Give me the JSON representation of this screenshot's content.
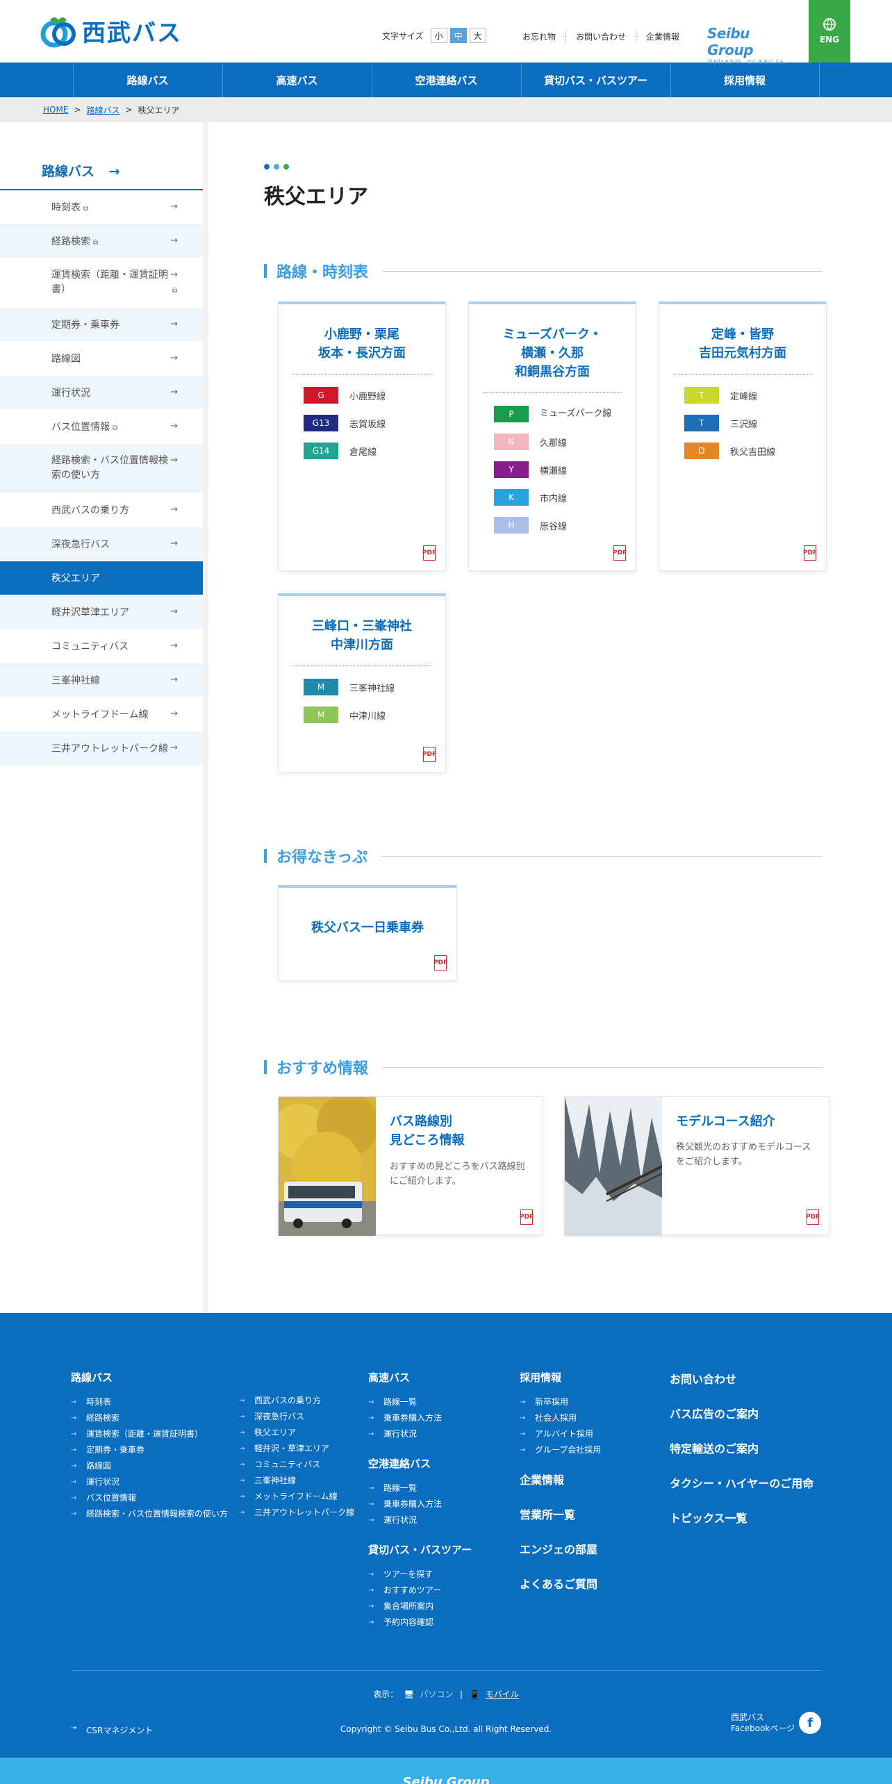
{
  "header": {
    "logo_text": "西武バス",
    "font_size_label": "文字サイズ",
    "font_sizes": [
      "小",
      "中",
      "大"
    ],
    "links": [
      "お忘れ物",
      "お問い合わせ",
      "企業情報"
    ],
    "group_logo": "Seibu Group",
    "group_tagline": "でかけるたび、はじまるじぶん。",
    "eng": "ENG"
  },
  "nav": [
    "路線バス",
    "高速バス",
    "空港連絡バス",
    "貸切バス・バスツアー",
    "採用情報"
  ],
  "breadcrumb": {
    "home": "HOME",
    "sep": ">",
    "parent": "路線バス",
    "current": "秩父エリア"
  },
  "sidebar": {
    "title": "路線バス",
    "items": [
      {
        "label": "時刻表",
        "ext": true
      },
      {
        "label": "経路検索",
        "ext": true
      },
      {
        "label": "運賃検索（距離・運賃証明書）",
        "ext": true
      },
      {
        "label": "定期券・乗車券",
        "ext": false
      },
      {
        "label": "路線図",
        "ext": false
      },
      {
        "label": "運行状況",
        "ext": false
      },
      {
        "label": "バス位置情報",
        "ext": true
      },
      {
        "label": "経路検索・バス位置情報検索の使い方",
        "ext": false
      },
      {
        "label": "西武バスの乗り方",
        "ext": false
      },
      {
        "label": "深夜急行バス",
        "ext": false
      },
      {
        "label": "秩父エリア",
        "ext": false,
        "active": true
      },
      {
        "label": "軽井沢草津エリア",
        "ext": false
      },
      {
        "label": "コミュニティバス",
        "ext": false
      },
      {
        "label": "三峯神社線",
        "ext": false
      },
      {
        "label": "メットライフドーム線",
        "ext": false
      },
      {
        "label": "三井アウトレットパーク線",
        "ext": false
      }
    ]
  },
  "main": {
    "title": "秩父エリア",
    "dot_colors": [
      "#0a6dbf",
      "#3ab0e8",
      "#3ba847"
    ],
    "section_routes": "路線・時刻表",
    "route_cards": [
      {
        "title": [
          "小鹿野・栗尾",
          "坂本・長沢方面"
        ],
        "routes": [
          {
            "code": "G",
            "name": "小鹿野線",
            "color": "#d0172b"
          },
          {
            "code": "G13",
            "name": "志賀坂線",
            "color": "#1f2c7f"
          },
          {
            "code": "G14",
            "name": "倉尾線",
            "color": "#1fa591"
          }
        ]
      },
      {
        "title": [
          "ミューズパーク・",
          "横瀬・久那",
          "和銅黒谷方面"
        ],
        "routes": [
          {
            "code": "P",
            "name": "ミューズパーク線",
            "color": "#1a9a4a"
          },
          {
            "code": "N",
            "name": "久那線",
            "color": "#f3b6bd"
          },
          {
            "code": "Y",
            "name": "横瀬線",
            "color": "#8b1d8a"
          },
          {
            "code": "K",
            "name": "市内線",
            "color": "#2aa2de"
          },
          {
            "code": "H",
            "name": "原谷線",
            "color": "#a9bfe6"
          }
        ]
      },
      {
        "title": [
          "定峰・皆野",
          "吉田元気村方面"
        ],
        "routes": [
          {
            "code": "T",
            "name": "定峰線",
            "color": "#c8d62e"
          },
          {
            "code": "T",
            "name": "三沢線",
            "color": "#1f6db5"
          },
          {
            "code": "D",
            "name": "秩父吉田線",
            "color": "#e38623"
          }
        ]
      },
      {
        "title": [
          "三峰口・三峯神社",
          "中津川方面"
        ],
        "routes": [
          {
            "code": "M",
            "name": "三峯神社線",
            "color": "#1d8aaa"
          },
          {
            "code": "M",
            "name": "中津川線",
            "color": "#8cc656"
          }
        ]
      }
    ],
    "section_ticket": "お得なきっぷ",
    "ticket_title": "秩父バス一日乗車券",
    "section_rec": "おすすめ情報",
    "rec_cards": [
      {
        "title": [
          "バス路線別",
          "見どころ情報"
        ],
        "desc": "おすすめの見どころをバス路線別にご紹介します。"
      },
      {
        "title": [
          "モデルコース紹介"
        ],
        "desc": "秩父観光のおすすめモデルコースをご紹介します。"
      }
    ],
    "pdf_icon": "pdf-icon"
  },
  "footer": {
    "col1": {
      "head": "路線バス",
      "left": [
        "時刻表",
        "経路検索",
        "運賃検索（距離・運賃証明書）",
        "定期券・乗車券",
        "路線図",
        "運行状況",
        "バス位置情報",
        "経路検索・バス位置情報検索の使い方"
      ],
      "right": [
        "西武バスの乗り方",
        "深夜急行バス",
        "秩父エリア",
        "軽井沢・草津エリア",
        "コミュニティバス",
        "三峯神社線",
        "メットライフドーム線",
        "三井アウトレットパーク線"
      ]
    },
    "col2": [
      {
        "head": "高速バス",
        "items": [
          "路線一覧",
          "乗車券購入方法",
          "運行状況"
        ]
      },
      {
        "head": "空港連絡バス",
        "items": [
          "路線一覧",
          "乗車券購入方法",
          "運行状況"
        ]
      },
      {
        "head": "貸切バス・バスツアー",
        "items": [
          "ツアーを探す",
          "おすすめツアー",
          "集合場所案内",
          "予約内容確認"
        ]
      }
    ],
    "col3": {
      "head": "採用情報",
      "items": [
        "新卒採用",
        "社会人採用",
        "アルバイト採用",
        "グループ会社採用"
      ],
      "links": [
        "企業情報",
        "営業所一覧",
        "エンジェの部屋",
        "よくあるご質問"
      ]
    },
    "col4": [
      "お問い合わせ",
      "バス広告のご案内",
      "特定輸送のご案内",
      "タクシー・ハイヤーのご用命",
      "トピックス一覧"
    ],
    "display_label": "表示：",
    "display_pc": "パソコン",
    "display_mobile": "モバイル",
    "csr": "CSRマネジメント",
    "copyright": "Copyright © Seibu Bus Co.,Ltd. all Right Reserved.",
    "facebook": [
      "西武バス",
      "Facebookページ"
    ],
    "bottom_logo": "Seibu Group"
  }
}
